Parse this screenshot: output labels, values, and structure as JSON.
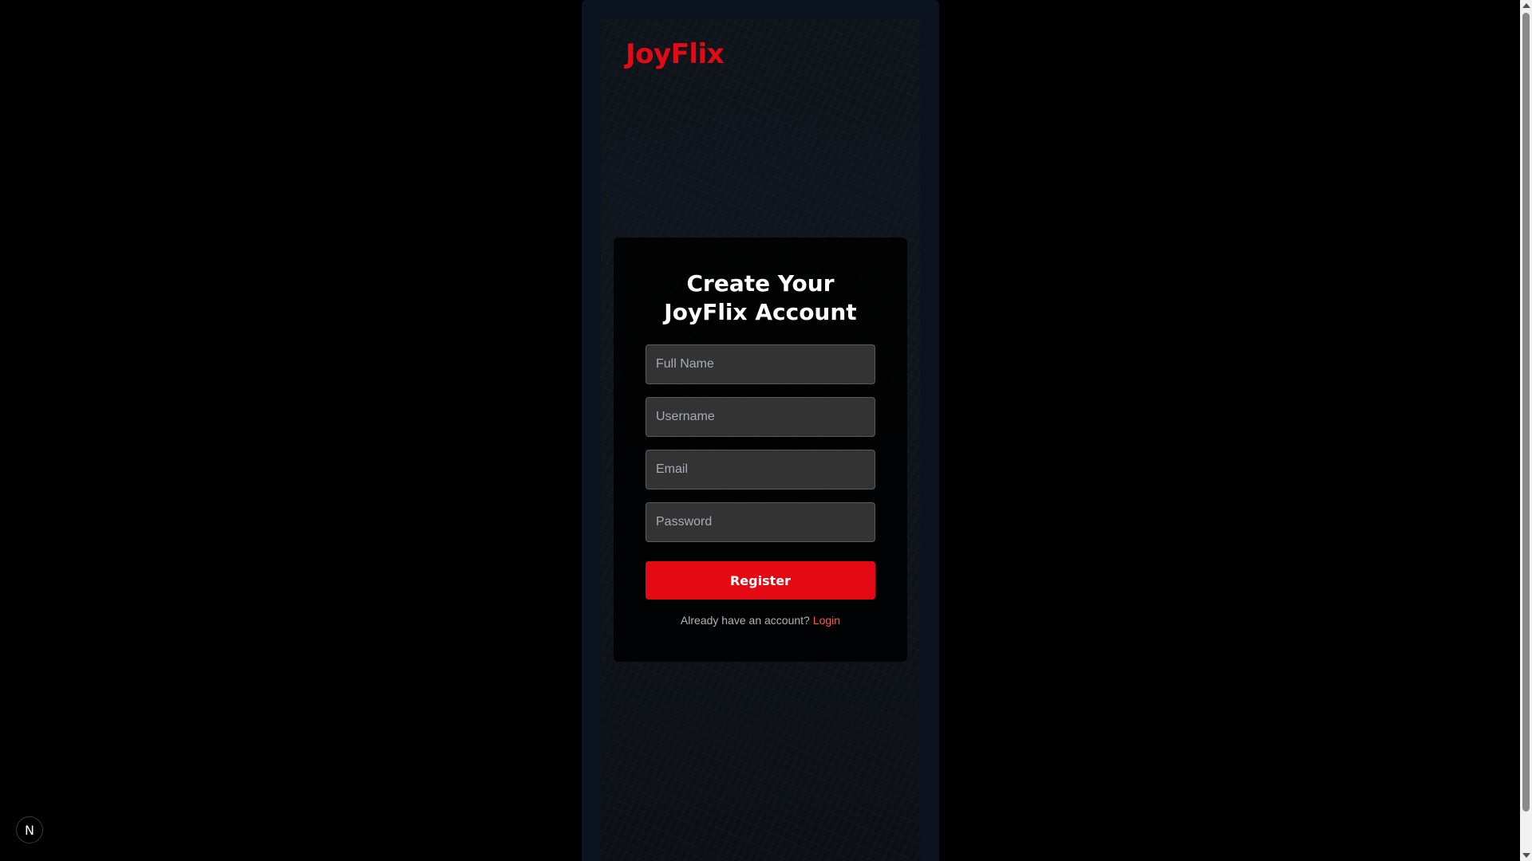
{
  "brand": {
    "logo_text": "JoyFlix",
    "accent_color": "#e50914",
    "link_color": "#ff5a3c"
  },
  "register_form": {
    "title": "Create Your JoyFlix Account",
    "fields": [
      {
        "name": "full-name",
        "placeholder": "Full Name",
        "value": ""
      },
      {
        "name": "username",
        "placeholder": "Username",
        "value": ""
      },
      {
        "name": "email",
        "placeholder": "Email",
        "value": ""
      },
      {
        "name": "password",
        "placeholder": "Password",
        "value": ""
      }
    ],
    "submit_label": "Register",
    "login_prompt": "Already have an account?",
    "login_link": "Login"
  },
  "dev_indicator": {
    "label": "N",
    "icon": "nextjs-icon"
  }
}
